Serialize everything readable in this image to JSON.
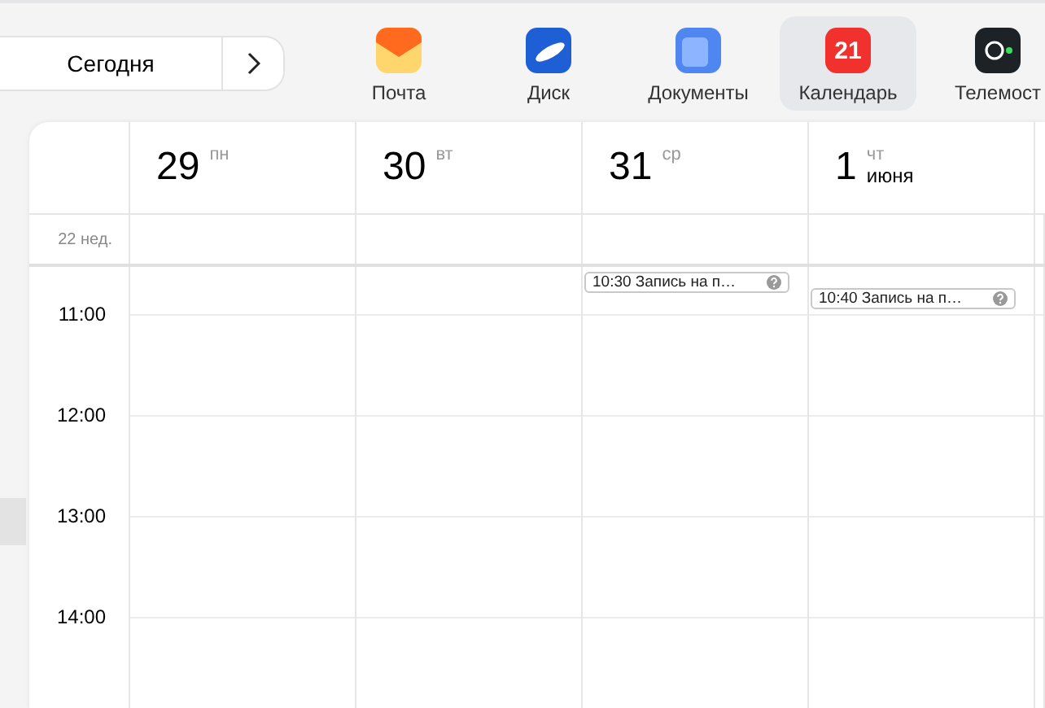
{
  "toolbar": {
    "today_button": "Сегодня"
  },
  "apps": [
    {
      "kind": "mail",
      "label": "Почта",
      "selected": false
    },
    {
      "kind": "disk",
      "label": "Диск",
      "selected": false
    },
    {
      "kind": "docs",
      "label": "Документы",
      "selected": false
    },
    {
      "kind": "calendar",
      "label": "Календарь",
      "selected": true,
      "icon_text": "21"
    },
    {
      "kind": "telemost",
      "label": "Телемост",
      "selected": false
    }
  ],
  "calendar": {
    "week_label": "22 нед.",
    "days": [
      {
        "number": "29",
        "weekday": "пн"
      },
      {
        "number": "30",
        "weekday": "вт"
      },
      {
        "number": "31",
        "weekday": "ср",
        "events": [
          {
            "time": "10:30",
            "title": "Запись на п…"
          }
        ]
      },
      {
        "number": "1",
        "weekday": "чт",
        "month": "июня",
        "events": [
          {
            "time": "10:40",
            "title": "Запись на п…"
          }
        ]
      }
    ],
    "hours": [
      "11:00",
      "12:00",
      "13:00",
      "14:00"
    ]
  }
}
